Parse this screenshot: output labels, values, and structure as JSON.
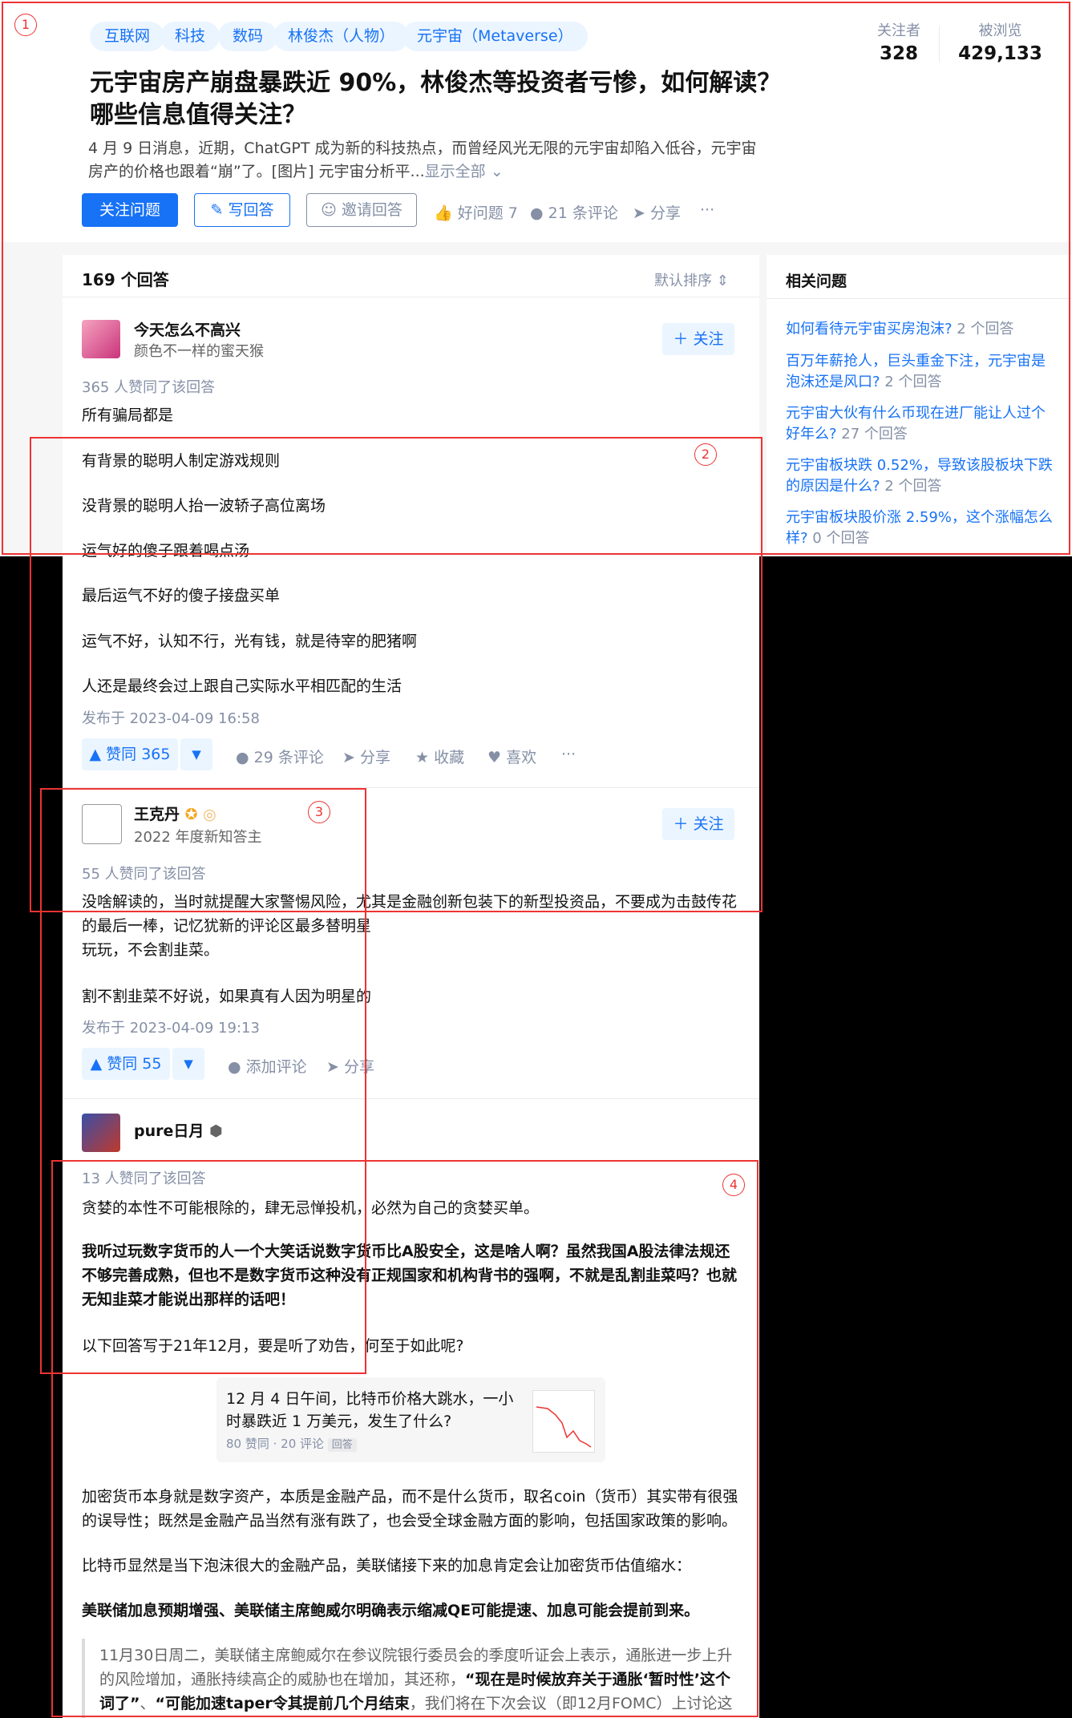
{
  "header": {
    "topics": [
      "互联网",
      "科技",
      "数码",
      "林俊杰（人物）",
      "元宇宙（Metaverse）"
    ],
    "title": "元宇宙房产崩盘暴跌近 90%，林俊杰等投资者亏惨，如何解读？哪些信息值得关注？",
    "description": "4 月 9 日消息，近期，ChatGPT 成为新的科技热点，而曾经风光无限的元宇宙却陷入低谷，元宇宙房产的价格也跟着“崩”了。[图片] 元宇宙分析平...",
    "show_all": "显示全部",
    "followers_label": "关注者",
    "followers_value": "328",
    "views_label": "被浏览",
    "views_value": "429,133",
    "buttons": {
      "follow_question": "关注问题",
      "write_answer": "写回答",
      "invite_answer": "邀请回答",
      "good_question": "好问题 7",
      "comments": "21 条评论",
      "share": "分享",
      "more": "···"
    }
  },
  "answers_header": {
    "count": "169 个回答",
    "sort": "默认排序"
  },
  "answers": [
    {
      "author": "今天怎么不高兴",
      "bio": "颜色不一样的蜜天猴",
      "follow": "关注",
      "votes_meta": "365 人赞同了该回答",
      "paragraphs": [
        "所有骗局都是",
        "有背景的聪明人制定游戏规则",
        "没背景的聪明人抬一波轿子高位离场",
        "运气好的傻子跟着喝点汤",
        "最后运气不好的傻子接盘买单",
        "运气不好，认知不行，光有钱，就是待宰的肥猪啊",
        "人还是最终会过上跟自己实际水平相匹配的生活"
      ],
      "published": "发布于 2023-04-09 16:58",
      "upvote": "赞同 365",
      "comments": "29 条评论",
      "share": "分享",
      "collect": "收藏",
      "like": "喜欢",
      "more": "···"
    },
    {
      "author": "王克丹",
      "bio": "2022 年度新知答主",
      "follow": "关注",
      "votes_meta": "55 人赞同了该回答",
      "paragraphs": [
        "没啥解读的，当时就提醒大家警惕风险，尤其是金融创新包装下的新型投资品，不要成为击鼓传花的最后一棒，记忆犹新的评论区最多替明星",
        "玩玩，不会割韭菜。",
        "割不割韭菜不好说，如果真有人因为明星的"
      ],
      "published": "发布于 2023-04-09 19:13",
      "upvote": "赞同 55",
      "comments": "添加评论",
      "share": "分享"
    },
    {
      "author": "pure日月",
      "votes_meta": "13 人赞同了该回答",
      "paragraphs": [
        "贪婪的本性不可能根除的，肆无忌惮投机，必然为自己的贪婪买单。",
        "我听过玩数字货币的人一个大笑话说数字货币比A股安全，这是啥人啊？虽然我国A股法律法规还不够完善成熟，但也不是数字货币这种没有正规国家和机构背书的强啊，不就是乱割韭菜吗？也就无知韭菜才能说出那样的话吧！",
        "以下回答写于21年12月，要是听了劝告，何至于如此呢?",
        "加密货币本身就是数字资产，本质是金融产品，而不是什么货币，取名coin（货币）其实带有很强的误导性；既然是金融产品当然有涨有跌了，也会受全球金融方面的影响，包括国家政策的影响。",
        "比特币显然是当下泡沫很大的金融产品，美联储接下来的加息肯定会让加密货币估值缩水：",
        "美联储加息预期增强、美联储主席鲍威尔明确表示缩减QE可能提速、加息可能会提前到来。"
      ],
      "link_card": {
        "title": "12 月 4 日午间，比特币价格大跳水，一小时暴跌近 1 万美元，发生了什么?",
        "meta": "80 赞同 · 20 评论",
        "tag": "回答"
      },
      "quote_plain_1": "11月30日周二，美联储主席鲍威尔在参议院银行委员会的季度听证会上表示，通胀进一步上升的风险增加，通胀持续高企的威胁也在增加，其还称，",
      "quote_bold_1": "“现在是时候放弃关于通胀‘暂时性’这个词了”",
      "quote_plain_2": "、",
      "quote_bold_2": "“可能加速taper令其提前几个月结束",
      "quote_plain_3": "，我们将在下次会议（即12月FOMC）上讨论这"
    }
  ],
  "sidebar": {
    "title": "相关问题",
    "questions": [
      {
        "text": "如何看待元宇宙买房泡沫?",
        "count": "2 个回答"
      },
      {
        "text": "百万年薪抢人，巨头重金下注，元宇宙是泡沫还是风口?",
        "count": "2 个回答"
      },
      {
        "text": "元宇宙大伙有什么币现在进厂能让人过个好年么?",
        "count": "27 个回答"
      },
      {
        "text": "元宇宙板块跌 0.52%，导致该股板块下跌的原因是什么?",
        "count": "2 个回答"
      },
      {
        "text": "元宇宙板块股价涨 2.59%，这个涨幅怎么样?",
        "count": "0 个回答"
      }
    ]
  },
  "annotations": [
    "1",
    "2",
    "3",
    "4"
  ],
  "colors": {
    "accent": "#1772f6",
    "annotation": "#e33333",
    "muted": "#8590a6"
  }
}
